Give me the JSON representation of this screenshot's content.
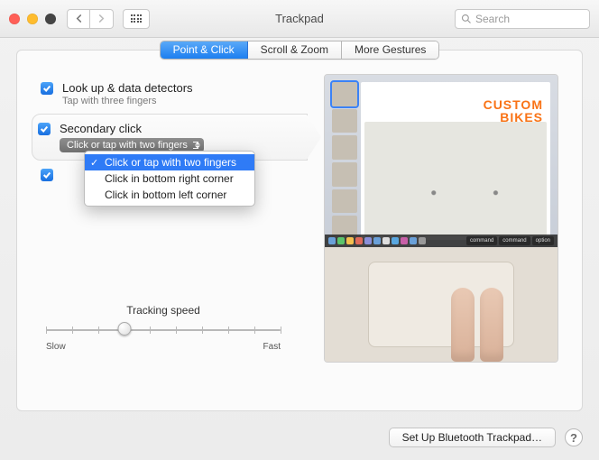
{
  "window": {
    "title": "Trackpad"
  },
  "search": {
    "placeholder": "Search"
  },
  "tabs": [
    "Point & Click",
    "Scroll & Zoom",
    "More Gestures"
  ],
  "activeTab": 0,
  "options": {
    "lookup": {
      "title": "Look up & data detectors",
      "sub": "Tap with three fingers",
      "checked": true
    },
    "secondary": {
      "title": "Secondary click",
      "popup": "Click or tap with two fingers",
      "checked": true
    },
    "third": {
      "title": "",
      "sub": "",
      "checked": true
    }
  },
  "dropdown": {
    "items": [
      "Click or tap with two fingers",
      "Click in bottom right corner",
      "Click in bottom left corner"
    ],
    "selectedIndex": 0
  },
  "slider": {
    "label": "Tracking speed",
    "minLabel": "Slow",
    "maxLabel": "Fast",
    "ticks": 10,
    "valueIndex": 3
  },
  "preview": {
    "headline1": "CUSTOM",
    "headline2": "BIKES",
    "keys": [
      "command",
      "command",
      "option"
    ]
  },
  "footer": {
    "setup": "Set Up Bluetooth Trackpad…"
  }
}
